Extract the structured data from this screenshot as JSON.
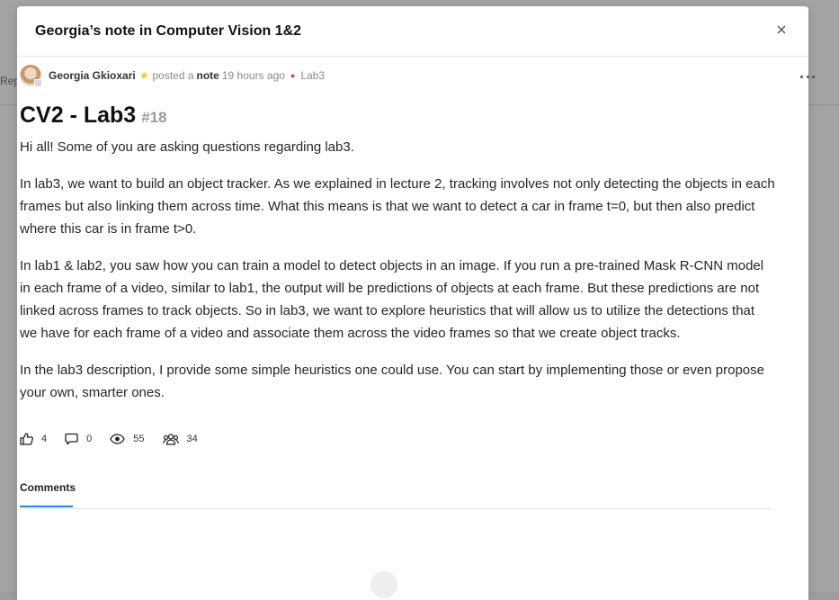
{
  "background": {
    "left_fragment": "Rep"
  },
  "modal": {
    "title": "Georgia’s note in Computer Vision 1&2",
    "close_icon": "close-icon"
  },
  "post": {
    "author": "Georgia Gkioxari",
    "posted_prefix": "posted a",
    "type": "note",
    "time": "19 hours ago",
    "tag": "Lab3",
    "title": "CV2 - Lab3",
    "number": "#18",
    "paragraphs": [
      "Hi all! Some of you are asking questions regarding lab3.",
      "In lab3, we want to build an object tracker. As we explained in lecture 2, tracking involves not only detecting the objects in each frames but also linking them across time. What this means is that we want to detect a car in frame t=0, but then also predict where this car is in frame t>0.",
      "In lab1 & lab2, you saw how you can train a model to detect objects in an image. If you run a pre-trained Mask R-CNN model in each frame of a video, similar to lab1, the output will be predictions of objects at each frame. But these predictions are not linked across frames to track objects. So in lab3, we want to explore heuristics that will allow us to utilize the detections that we have for each frame of a video and associate them across the video frames so that we create object tracks.",
      "In the lab3 description, I provide some simple heuristics one could use. You can start by implementing those or even propose your own, smarter ones."
    ]
  },
  "stats": {
    "likes": "4",
    "comments": "0",
    "views": "55",
    "participants": "34"
  },
  "tabs": {
    "comments_label": "Comments"
  },
  "colors": {
    "accent": "#1e88e5",
    "tag_dot": "#e53935",
    "star": "#f3c623"
  }
}
